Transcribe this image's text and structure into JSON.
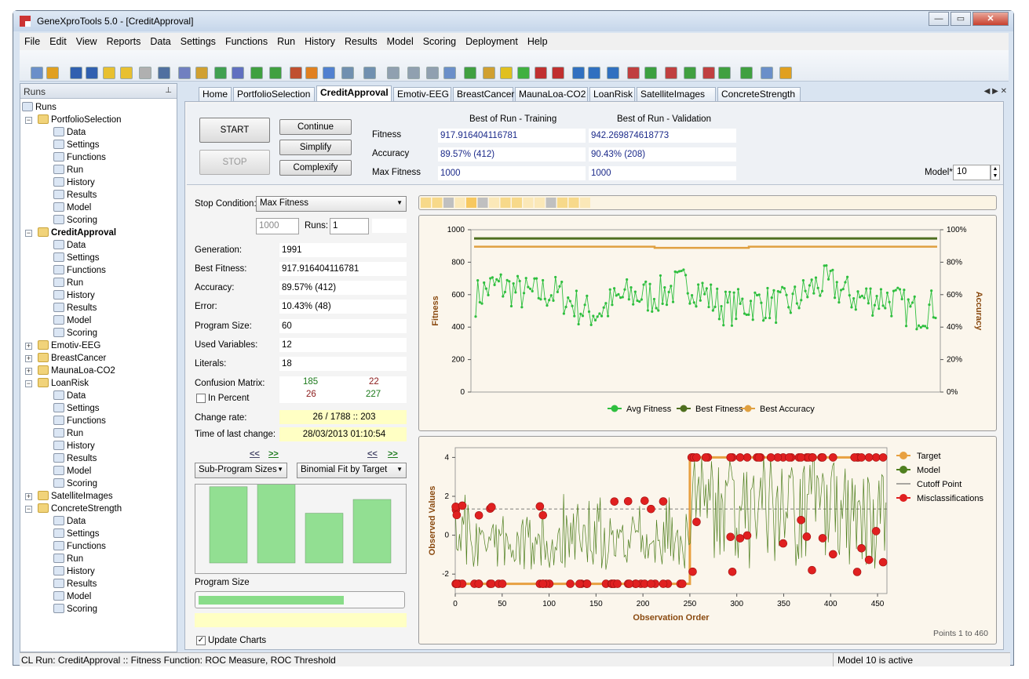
{
  "window": {
    "title": "GeneXproTools 5.0 - [CreditApproval]"
  },
  "menu": [
    "File",
    "Edit",
    "View",
    "Reports",
    "Data",
    "Settings",
    "Functions",
    "Run",
    "History",
    "Results",
    "Model",
    "Scoring",
    "Deployment",
    "Help"
  ],
  "runs_panel": {
    "title": "Runs",
    "root": "Runs",
    "projects": [
      {
        "name": "PortfolioSelection",
        "expanded": true,
        "children": [
          "Data",
          "Settings",
          "Functions",
          "Run",
          "History",
          "Results",
          "Model",
          "Scoring"
        ]
      },
      {
        "name": "CreditApproval",
        "expanded": true,
        "bold": true,
        "children": [
          "Data",
          "Settings",
          "Functions",
          "Run",
          "History",
          "Results",
          "Model",
          "Scoring"
        ]
      },
      {
        "name": "Emotiv-EEG",
        "expanded": false
      },
      {
        "name": "BreastCancer",
        "expanded": false
      },
      {
        "name": "MaunaLoa-CO2",
        "expanded": false
      },
      {
        "name": "LoanRisk",
        "expanded": true,
        "children": [
          "Data",
          "Settings",
          "Functions",
          "Run",
          "History",
          "Results",
          "Model",
          "Scoring"
        ]
      },
      {
        "name": "SatelliteImages",
        "expanded": false
      },
      {
        "name": "ConcreteStrength",
        "expanded": true,
        "children": [
          "Data",
          "Settings",
          "Functions",
          "Run",
          "History",
          "Results",
          "Model",
          "Scoring"
        ]
      }
    ]
  },
  "tabs": [
    "Home",
    "PortfolioSelection",
    "CreditApproval",
    "Emotiv-EEG",
    "BreastCancer",
    "MaunaLoa-CO2",
    "LoanRisk",
    "SatelliteImages",
    "ConcreteStrength"
  ],
  "active_tab": "CreditApproval",
  "controls": {
    "start": "START",
    "stop": "STOP",
    "continue": "Continue",
    "simplify": "Simplify",
    "complexify": "Complexify"
  },
  "best_of_run": {
    "training_header": "Best of Run - Training",
    "validation_header": "Best of Run - Validation",
    "rows": [
      {
        "label": "Fitness",
        "training": "917.916404116781",
        "validation": "942.269874618773"
      },
      {
        "label": "Accuracy",
        "training": "89.57% (412)",
        "validation": "90.43% (208)"
      },
      {
        "label": "Max Fitness",
        "training": "1000",
        "validation": "1000"
      }
    ],
    "model_label": "Model*:",
    "model_value": "10"
  },
  "run_stats": {
    "stop_condition_label": "Stop Condition:",
    "stop_condition_value": "Max Fitness",
    "stop_value": "1000",
    "runs_label": "Runs:",
    "runs_value": "1",
    "generation": {
      "label": "Generation:",
      "value": "1991"
    },
    "best_fitness": {
      "label": "Best Fitness:",
      "value": "917.916404116781"
    },
    "accuracy": {
      "label": "Accuracy:",
      "value": "89.57% (412)"
    },
    "error": {
      "label": "Error:",
      "value": "10.43% (48)"
    },
    "program_size": {
      "label": "Program Size:",
      "value": "60"
    },
    "used_variables": {
      "label": "Used Variables:",
      "value": "12"
    },
    "literals": {
      "label": "Literals:",
      "value": "18"
    },
    "confusion": {
      "label": "Confusion Matrix:",
      "tp": "185",
      "fn": "22",
      "fp": "26",
      "tn": "227"
    },
    "in_percent": "In Percent",
    "change_rate": {
      "label": "Change rate:",
      "value": "26 / 1788 :: 203"
    },
    "last_change": {
      "label": "Time of last change:",
      "value": "28/03/2013 01:10:54"
    },
    "nav_prev": "<<",
    "nav_next": ">>",
    "sub_program_select": "Sub-Program Sizes",
    "binomial_select": "Binomial Fit by Target",
    "sub_program_values": [
      0.72,
      0.76,
      0.47,
      0.6
    ],
    "program_size_label": "Program Size",
    "program_size_fraction": 0.7,
    "update_charts": "Update Charts"
  },
  "chart_data": [
    {
      "type": "line",
      "ylabel": "Fitness",
      "y2label": "Accuracy",
      "ylim": [
        0,
        1000
      ],
      "y2lim": [
        0,
        100
      ],
      "yticks": [
        "0",
        "200",
        "400",
        "600",
        "800",
        "1000"
      ],
      "y2ticks": [
        "0%",
        "20%",
        "40%",
        "60%",
        "80%",
        "100%"
      ],
      "series": [
        {
          "name": "Avg Fitness",
          "color": "#2fbf3f"
        },
        {
          "name": "Best Fitness",
          "color": "#4f6f1f"
        },
        {
          "name": "Best Accuracy",
          "color": "#e0a040"
        }
      ],
      "legend": "bottom",
      "best_fitness_level": 917,
      "best_accuracy_level": 89.57,
      "avg_fitness_mean": 580
    },
    {
      "type": "scatter",
      "xlabel": "Observation Order",
      "ylabel": "Observed Values",
      "xlim": [
        0,
        460
      ],
      "ylim": [
        -3,
        4.5
      ],
      "xticks": [
        "0",
        "50",
        "100",
        "150",
        "200",
        "250",
        "300",
        "350",
        "400",
        "450"
      ],
      "yticks": [
        "-2",
        "0",
        "2",
        "4"
      ],
      "series": [
        {
          "name": "Target",
          "color": "#e8a040"
        },
        {
          "name": "Model",
          "color": "#4f7f1f"
        },
        {
          "name": "Cutoff Point",
          "color": "#555555"
        },
        {
          "name": "Misclassifications",
          "color": "#e02020"
        }
      ],
      "legend": "right",
      "target_low": -2.5,
      "target_high": 4,
      "target_switch": 250,
      "cutoff": 1.35,
      "points_label": "Points 1 to 460"
    }
  ],
  "status": {
    "left": "CL Run: CreditApproval :: Fitness Function: ROC Measure, ROC Threshold",
    "right": "Model 10 is active"
  }
}
